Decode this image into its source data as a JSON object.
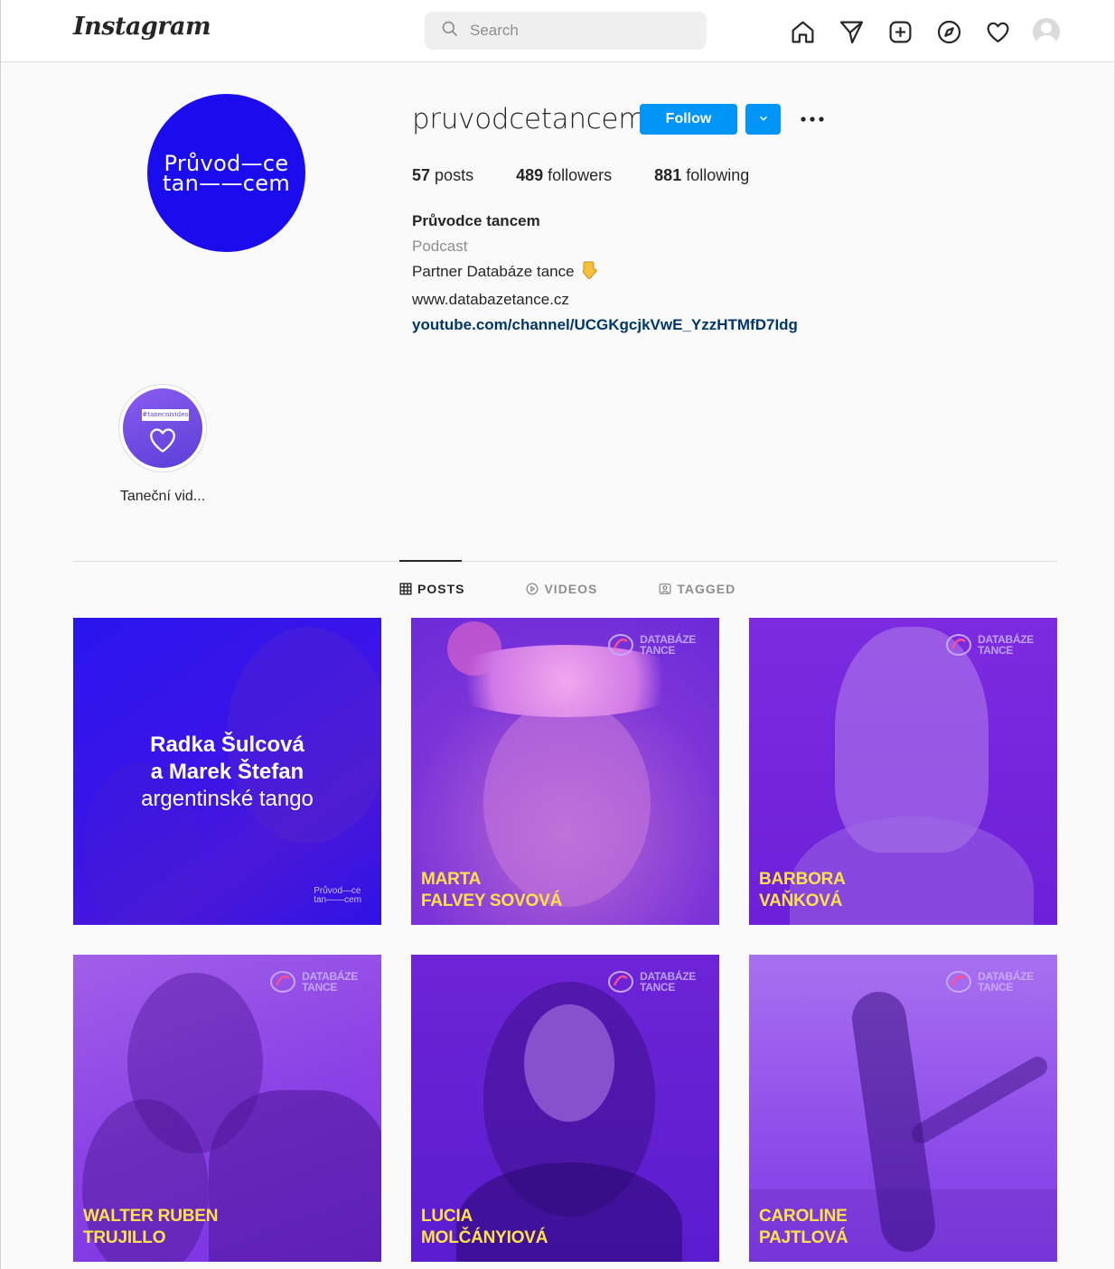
{
  "nav": {
    "logo": "Instagram",
    "search_placeholder": "Search",
    "icons": [
      "home-icon",
      "direct-icon",
      "new-post-icon",
      "explore-icon",
      "activity-icon",
      "profile-avatar"
    ]
  },
  "profile": {
    "picture_text_line1": "Průvod—ce",
    "picture_text_line2": "tan——cem",
    "username": "pruvodcetancem",
    "follow_label": "Follow",
    "more_label": "•••",
    "stats": {
      "posts_count": "57",
      "posts_label": "posts",
      "followers_count": "489",
      "followers_label": "followers",
      "following_count": "881",
      "following_label": "following"
    },
    "bio": {
      "name": "Průvodce tancem",
      "category": "Podcast",
      "line1": "Partner Databáze tance",
      "line2": "www.databazetance.cz",
      "link": "youtube.com/channel/UCGKgcjkVwE_YzzHTMfD7Idg"
    }
  },
  "highlights": [
    {
      "label": "Taneční vid...",
      "tag": "#tanecnivideo"
    }
  ],
  "tabs": [
    {
      "label": "POSTS",
      "icon": "grid-icon",
      "active": true
    },
    {
      "label": "VIDEOS",
      "icon": "play-icon",
      "active": false
    },
    {
      "label": "TAGGED",
      "icon": "tagged-icon",
      "active": false
    }
  ],
  "posts": {
    "brand_text": "DATABÁZE\nTANCE",
    "featured": {
      "title_bold": "Radka Šulcová\na Marek Štefan",
      "title_light": "argentinské tango",
      "mini_logo": "Průvod—ce\ntan——cem"
    },
    "captions": [
      "MARTA\nFALVEY SOVOVÁ",
      "BARBORA\nVAŇKOVÁ",
      "WALTER RUBEN\nTRUJILLO",
      "LUCIA\nMOLČÁNYIOVÁ",
      "CAROLINE\nPAJTLOVÁ"
    ]
  },
  "colors": {
    "accent_blue": "#0095f6",
    "profile_blue": "#1b0ced",
    "caption_yellow": "#ffe24a",
    "link_navy": "#00376b"
  }
}
